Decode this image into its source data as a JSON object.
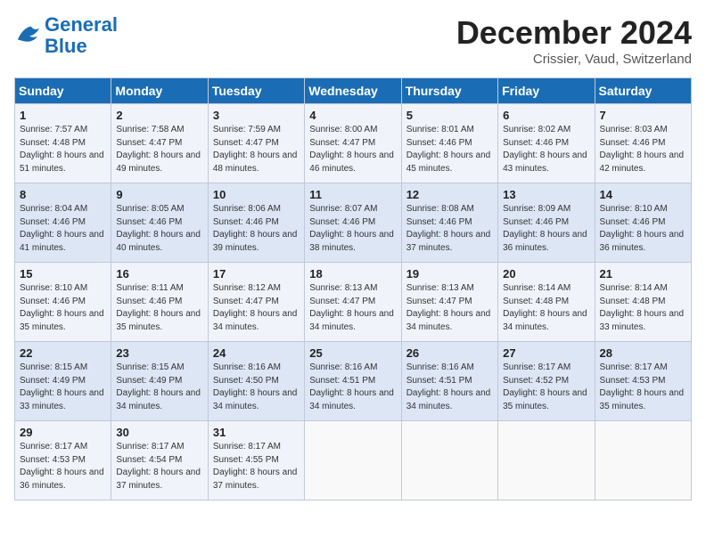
{
  "header": {
    "logo_line1": "General",
    "logo_line2": "Blue",
    "month_title": "December 2024",
    "location": "Crissier, Vaud, Switzerland"
  },
  "weekdays": [
    "Sunday",
    "Monday",
    "Tuesday",
    "Wednesday",
    "Thursday",
    "Friday",
    "Saturday"
  ],
  "weeks": [
    [
      {
        "day": "1",
        "sunrise": "7:57 AM",
        "sunset": "4:48 PM",
        "daylight": "8 hours and 51 minutes."
      },
      {
        "day": "2",
        "sunrise": "7:58 AM",
        "sunset": "4:47 PM",
        "daylight": "8 hours and 49 minutes."
      },
      {
        "day": "3",
        "sunrise": "7:59 AM",
        "sunset": "4:47 PM",
        "daylight": "8 hours and 48 minutes."
      },
      {
        "day": "4",
        "sunrise": "8:00 AM",
        "sunset": "4:47 PM",
        "daylight": "8 hours and 46 minutes."
      },
      {
        "day": "5",
        "sunrise": "8:01 AM",
        "sunset": "4:46 PM",
        "daylight": "8 hours and 45 minutes."
      },
      {
        "day": "6",
        "sunrise": "8:02 AM",
        "sunset": "4:46 PM",
        "daylight": "8 hours and 43 minutes."
      },
      {
        "day": "7",
        "sunrise": "8:03 AM",
        "sunset": "4:46 PM",
        "daylight": "8 hours and 42 minutes."
      }
    ],
    [
      {
        "day": "8",
        "sunrise": "8:04 AM",
        "sunset": "4:46 PM",
        "daylight": "8 hours and 41 minutes."
      },
      {
        "day": "9",
        "sunrise": "8:05 AM",
        "sunset": "4:46 PM",
        "daylight": "8 hours and 40 minutes."
      },
      {
        "day": "10",
        "sunrise": "8:06 AM",
        "sunset": "4:46 PM",
        "daylight": "8 hours and 39 minutes."
      },
      {
        "day": "11",
        "sunrise": "8:07 AM",
        "sunset": "4:46 PM",
        "daylight": "8 hours and 38 minutes."
      },
      {
        "day": "12",
        "sunrise": "8:08 AM",
        "sunset": "4:46 PM",
        "daylight": "8 hours and 37 minutes."
      },
      {
        "day": "13",
        "sunrise": "8:09 AM",
        "sunset": "4:46 PM",
        "daylight": "8 hours and 36 minutes."
      },
      {
        "day": "14",
        "sunrise": "8:10 AM",
        "sunset": "4:46 PM",
        "daylight": "8 hours and 36 minutes."
      }
    ],
    [
      {
        "day": "15",
        "sunrise": "8:10 AM",
        "sunset": "4:46 PM",
        "daylight": "8 hours and 35 minutes."
      },
      {
        "day": "16",
        "sunrise": "8:11 AM",
        "sunset": "4:46 PM",
        "daylight": "8 hours and 35 minutes."
      },
      {
        "day": "17",
        "sunrise": "8:12 AM",
        "sunset": "4:47 PM",
        "daylight": "8 hours and 34 minutes."
      },
      {
        "day": "18",
        "sunrise": "8:13 AM",
        "sunset": "4:47 PM",
        "daylight": "8 hours and 34 minutes."
      },
      {
        "day": "19",
        "sunrise": "8:13 AM",
        "sunset": "4:47 PM",
        "daylight": "8 hours and 34 minutes."
      },
      {
        "day": "20",
        "sunrise": "8:14 AM",
        "sunset": "4:48 PM",
        "daylight": "8 hours and 34 minutes."
      },
      {
        "day": "21",
        "sunrise": "8:14 AM",
        "sunset": "4:48 PM",
        "daylight": "8 hours and 33 minutes."
      }
    ],
    [
      {
        "day": "22",
        "sunrise": "8:15 AM",
        "sunset": "4:49 PM",
        "daylight": "8 hours and 33 minutes."
      },
      {
        "day": "23",
        "sunrise": "8:15 AM",
        "sunset": "4:49 PM",
        "daylight": "8 hours and 34 minutes."
      },
      {
        "day": "24",
        "sunrise": "8:16 AM",
        "sunset": "4:50 PM",
        "daylight": "8 hours and 34 minutes."
      },
      {
        "day": "25",
        "sunrise": "8:16 AM",
        "sunset": "4:51 PM",
        "daylight": "8 hours and 34 minutes."
      },
      {
        "day": "26",
        "sunrise": "8:16 AM",
        "sunset": "4:51 PM",
        "daylight": "8 hours and 34 minutes."
      },
      {
        "day": "27",
        "sunrise": "8:17 AM",
        "sunset": "4:52 PM",
        "daylight": "8 hours and 35 minutes."
      },
      {
        "day": "28",
        "sunrise": "8:17 AM",
        "sunset": "4:53 PM",
        "daylight": "8 hours and 35 minutes."
      }
    ],
    [
      {
        "day": "29",
        "sunrise": "8:17 AM",
        "sunset": "4:53 PM",
        "daylight": "8 hours and 36 minutes."
      },
      {
        "day": "30",
        "sunrise": "8:17 AM",
        "sunset": "4:54 PM",
        "daylight": "8 hours and 37 minutes."
      },
      {
        "day": "31",
        "sunrise": "8:17 AM",
        "sunset": "4:55 PM",
        "daylight": "8 hours and 37 minutes."
      },
      null,
      null,
      null,
      null
    ]
  ]
}
